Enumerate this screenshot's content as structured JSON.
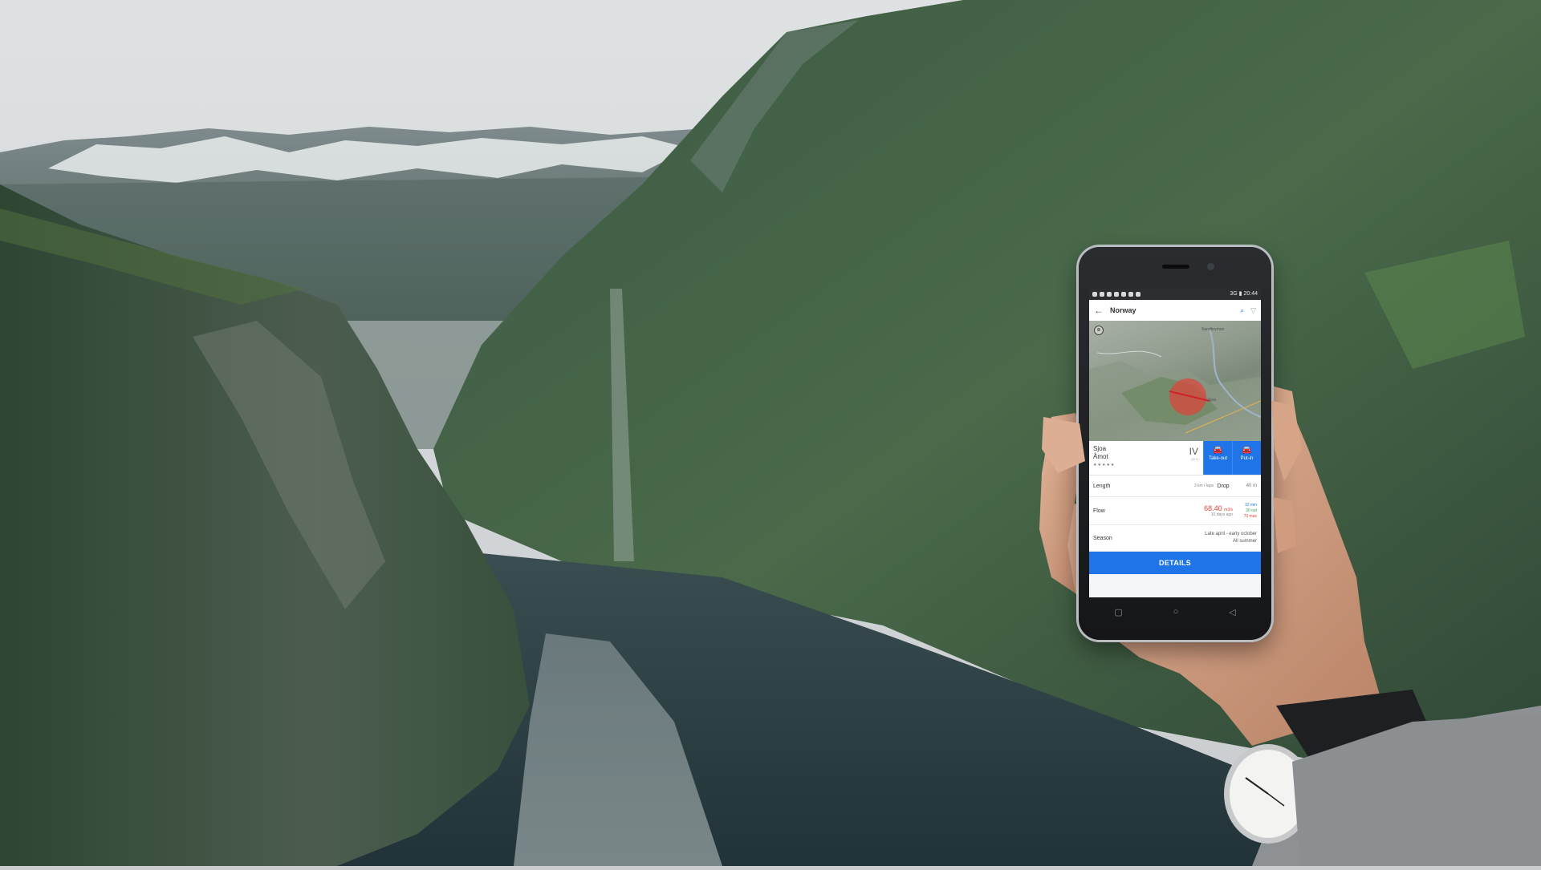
{
  "app": {
    "status_time": "20:44",
    "status_network": "3G",
    "header_title": "Norway",
    "icons": [
      "back-arrow-icon",
      "search-icon",
      "filter-icon"
    ],
    "map_labels": [
      "Sandbrymon",
      "Sjoa"
    ],
    "map_marker_color": "#e0463a",
    "river_name": "Sjoa",
    "section_name": "Åmot",
    "stars": "★★★★★",
    "grade": "IV",
    "grade_note": "(IV+)",
    "take_out_label": "Take-out",
    "put_in_label": "Put-in",
    "length_label": "Length",
    "length_value": "3 km / laps",
    "drop_label": "Drop",
    "drop_value": "40 m",
    "flow_label": "Flow",
    "flow_value": "68.40",
    "flow_unit": "m3/s",
    "flow_age": "10 days ago",
    "flow_min": "12 min",
    "flow_opt": "30 opt",
    "flow_max": "70 max",
    "season_label": "Season",
    "season_line1": "Late april - early october",
    "season_line2": "All summer",
    "details_button": "DETAILS",
    "accent_color": "#1f74e8"
  }
}
